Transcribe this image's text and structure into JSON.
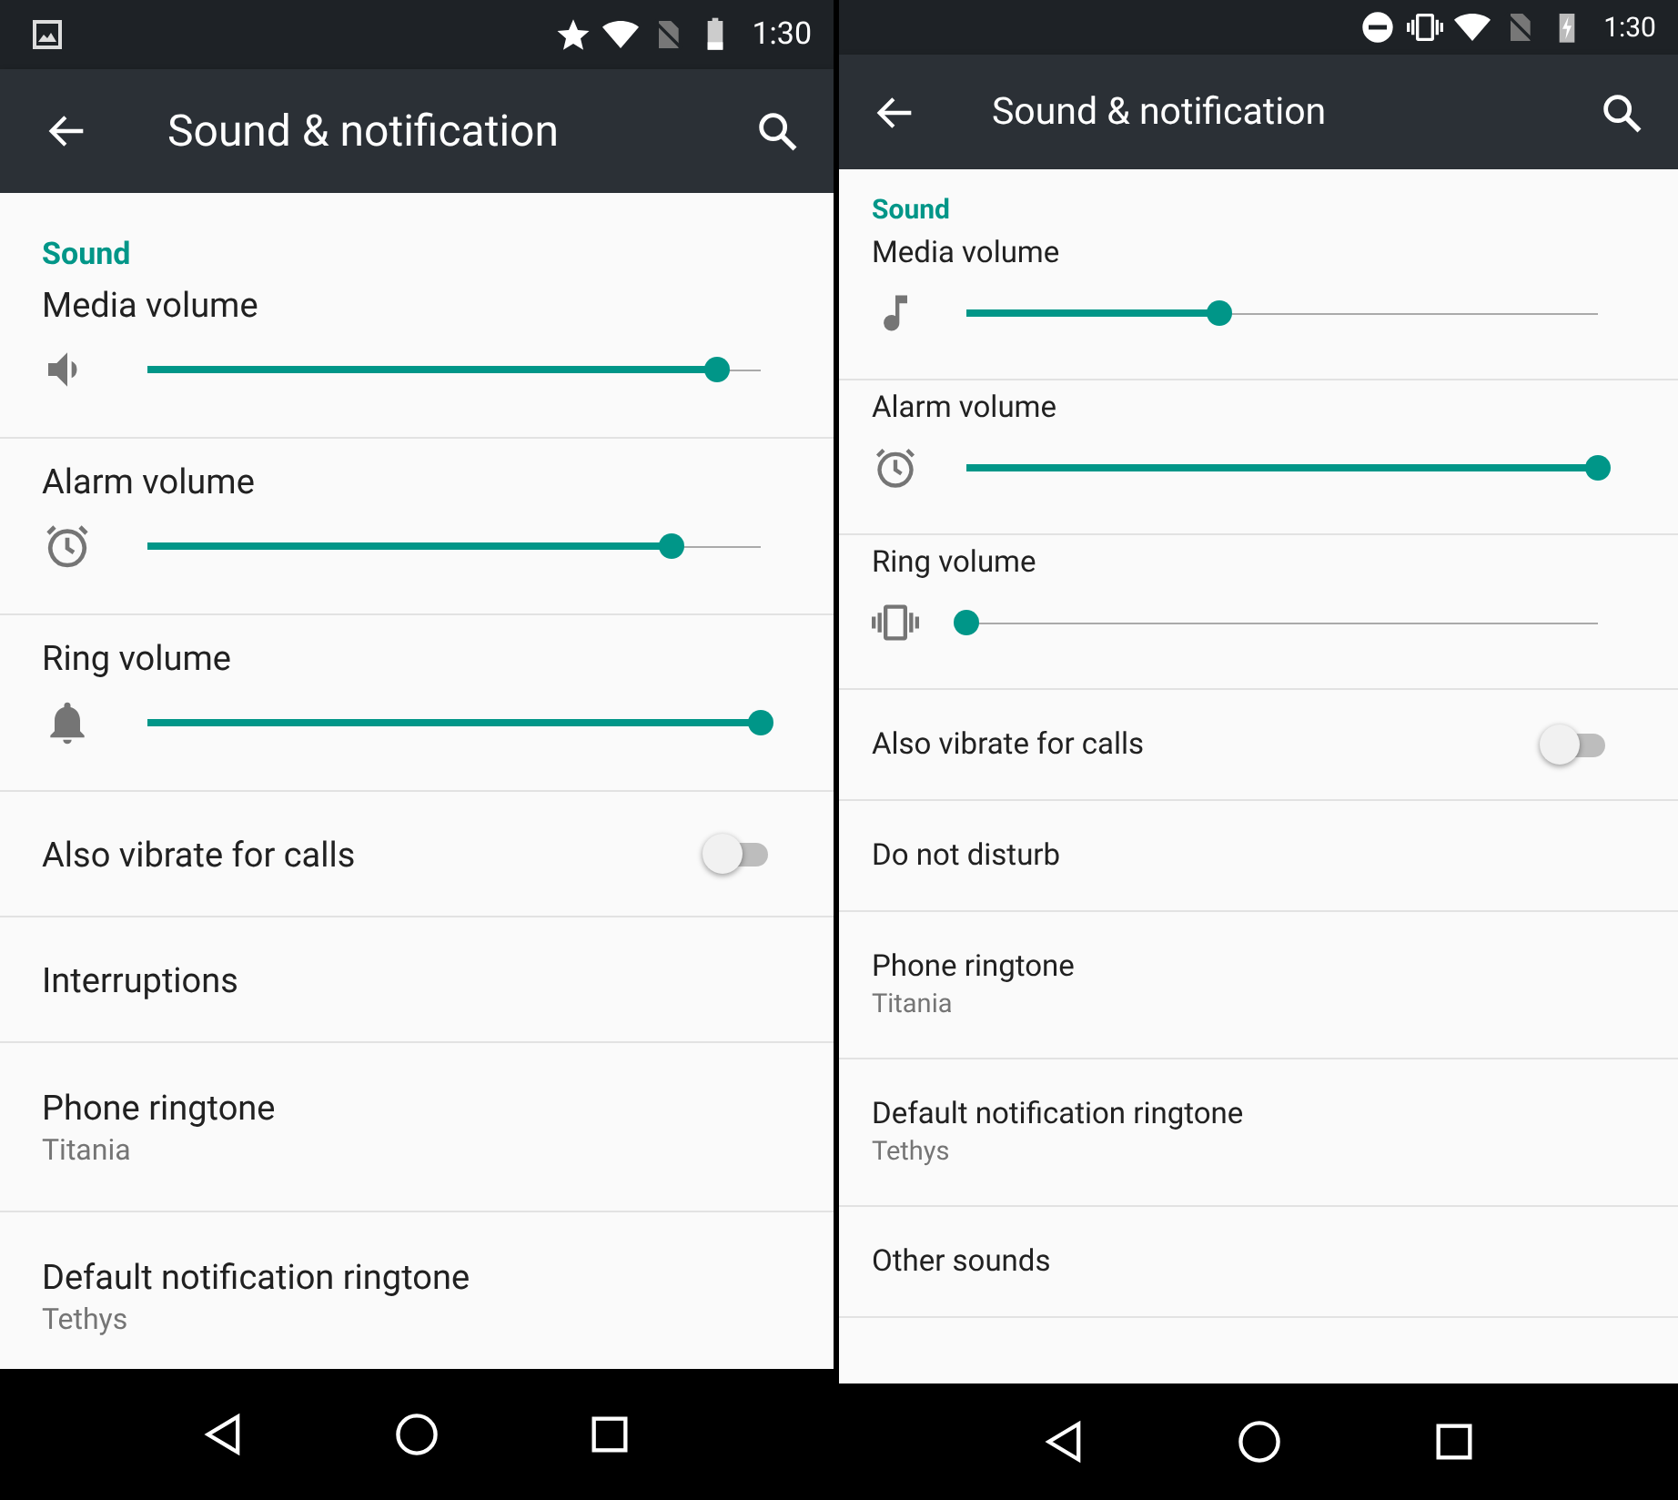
{
  "phones": [
    {
      "status_bar": {
        "time": "1:30"
      },
      "toolbar": {
        "title": "Sound & notification"
      },
      "section": "Sound",
      "items": [
        {
          "kind": "slider",
          "label": "Media volume",
          "level": 0.93
        },
        {
          "kind": "slider",
          "label": "Alarm volume",
          "level": 0.855
        },
        {
          "kind": "slider",
          "label": "Ring volume",
          "level": 1.0
        },
        {
          "kind": "toggle",
          "label": "Also vibrate for calls",
          "on": false
        },
        {
          "kind": "plain",
          "label": "Interruptions"
        },
        {
          "kind": "plain",
          "label": "Phone ringtone",
          "summary": "Titania"
        },
        {
          "kind": "plain",
          "label": "Default notification ringtone",
          "summary": "Tethys"
        }
      ]
    },
    {
      "status_bar": {
        "time": "1:30"
      },
      "toolbar": {
        "title": "Sound & notification"
      },
      "section": "Sound",
      "items": [
        {
          "kind": "slider",
          "label": "Media volume",
          "level": 0.4
        },
        {
          "kind": "slider",
          "label": "Alarm volume",
          "level": 1.0
        },
        {
          "kind": "slider",
          "label": "Ring volume",
          "level": 0.0
        },
        {
          "kind": "toggle",
          "label": "Also vibrate for calls",
          "on": false
        },
        {
          "kind": "plain",
          "label": "Do not disturb"
        },
        {
          "kind": "plain",
          "label": "Phone ringtone",
          "summary": "Titania"
        },
        {
          "kind": "plain",
          "label": "Default notification ringtone",
          "summary": "Tethys"
        },
        {
          "kind": "plain",
          "label": "Other sounds"
        }
      ]
    }
  ]
}
